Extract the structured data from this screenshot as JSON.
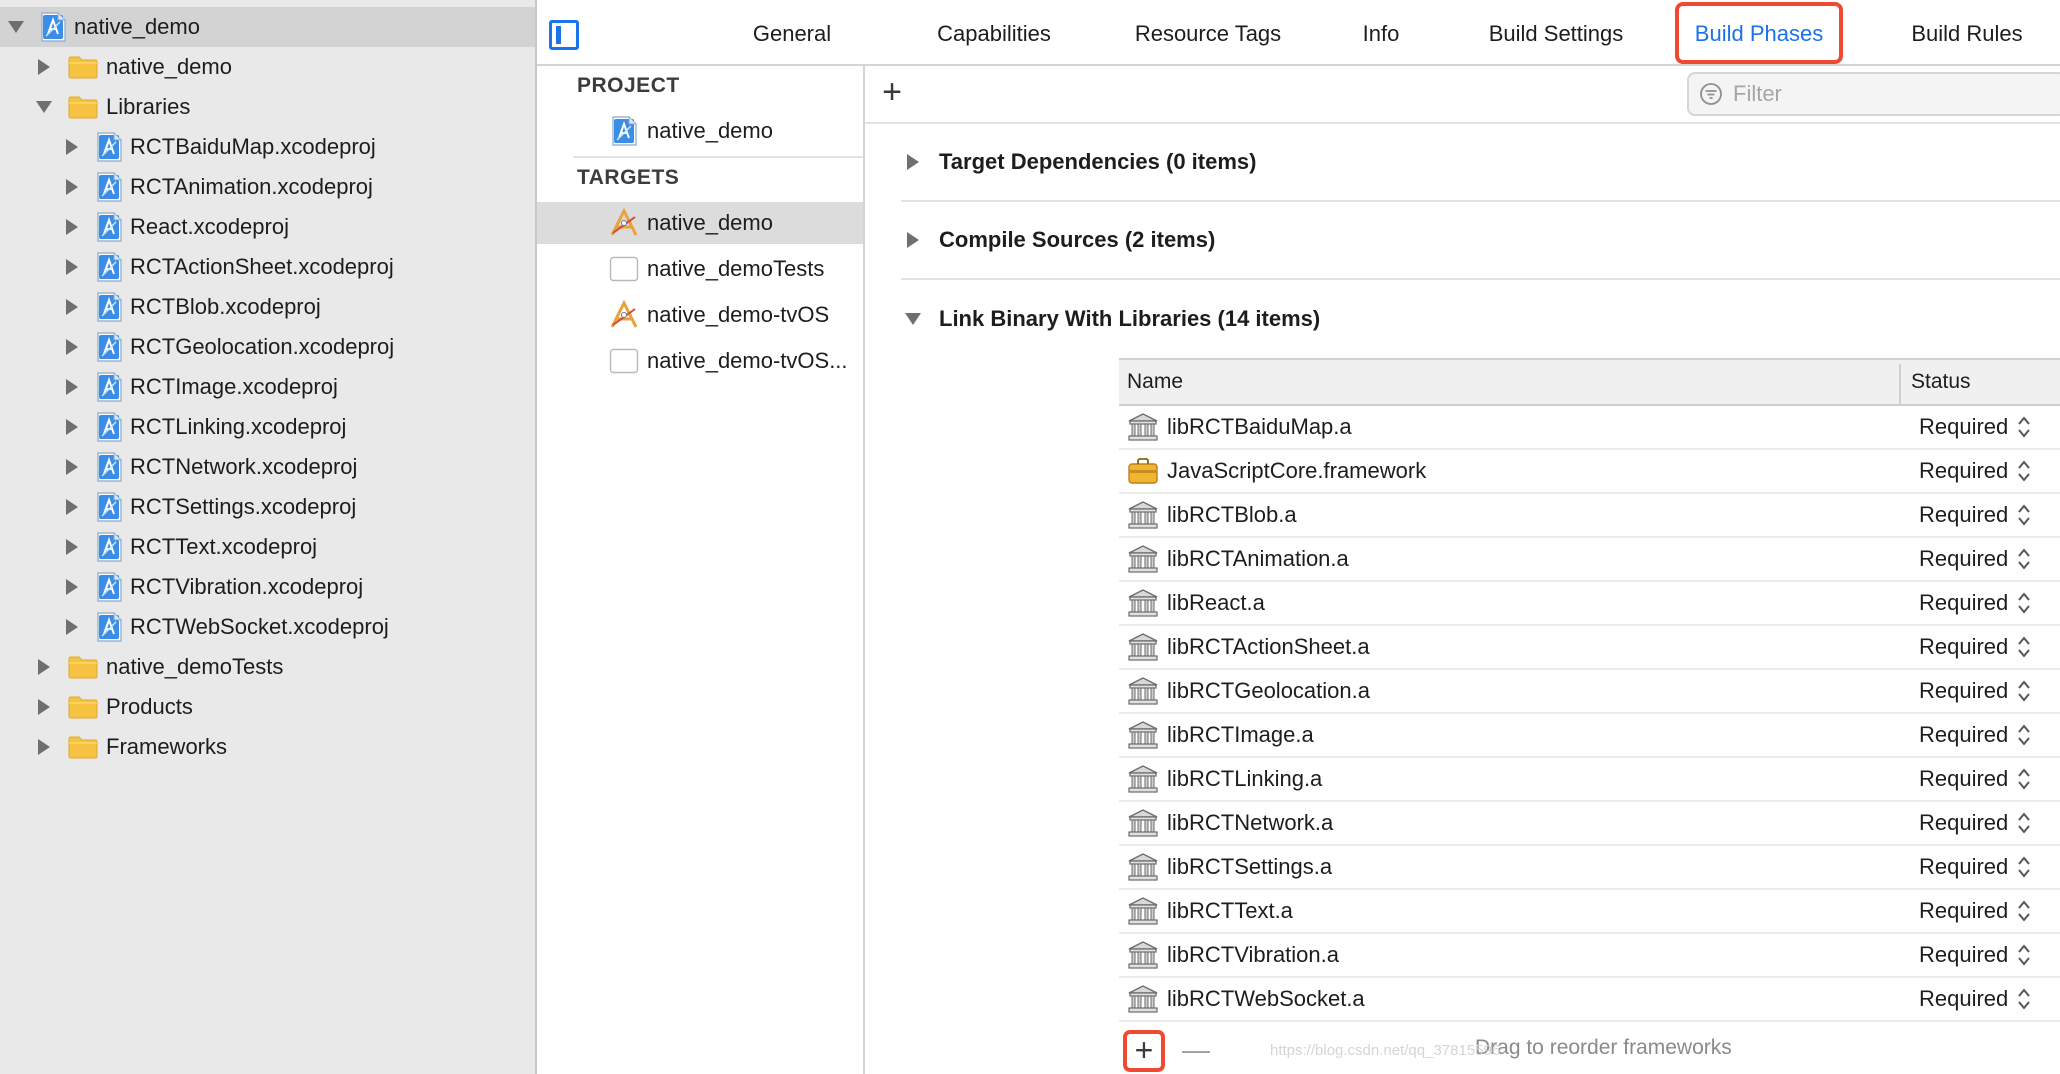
{
  "navigator": {
    "items": [
      {
        "label": "native_demo",
        "indent": 0,
        "expanded": true,
        "icon": "xcodeproj-icon",
        "selected": true
      },
      {
        "label": "native_demo",
        "indent": 1,
        "expanded": false,
        "icon": "folder-icon"
      },
      {
        "label": "Libraries",
        "indent": 1,
        "expanded": true,
        "icon": "folder-icon"
      },
      {
        "label": "RCTBaiduMap.xcodeproj",
        "indent": 2,
        "expanded": false,
        "icon": "xcodeproj-icon"
      },
      {
        "label": "RCTAnimation.xcodeproj",
        "indent": 2,
        "expanded": false,
        "icon": "xcodeproj-icon"
      },
      {
        "label": "React.xcodeproj",
        "indent": 2,
        "expanded": false,
        "icon": "xcodeproj-icon"
      },
      {
        "label": "RCTActionSheet.xcodeproj",
        "indent": 2,
        "expanded": false,
        "icon": "xcodeproj-icon"
      },
      {
        "label": "RCTBlob.xcodeproj",
        "indent": 2,
        "expanded": false,
        "icon": "xcodeproj-icon"
      },
      {
        "label": "RCTGeolocation.xcodeproj",
        "indent": 2,
        "expanded": false,
        "icon": "xcodeproj-icon"
      },
      {
        "label": "RCTImage.xcodeproj",
        "indent": 2,
        "expanded": false,
        "icon": "xcodeproj-icon"
      },
      {
        "label": "RCTLinking.xcodeproj",
        "indent": 2,
        "expanded": false,
        "icon": "xcodeproj-icon"
      },
      {
        "label": "RCTNetwork.xcodeproj",
        "indent": 2,
        "expanded": false,
        "icon": "xcodeproj-icon"
      },
      {
        "label": "RCTSettings.xcodeproj",
        "indent": 2,
        "expanded": false,
        "icon": "xcodeproj-icon"
      },
      {
        "label": "RCTText.xcodeproj",
        "indent": 2,
        "expanded": false,
        "icon": "xcodeproj-icon"
      },
      {
        "label": "RCTVibration.xcodeproj",
        "indent": 2,
        "expanded": false,
        "icon": "xcodeproj-icon"
      },
      {
        "label": "RCTWebSocket.xcodeproj",
        "indent": 2,
        "expanded": false,
        "icon": "xcodeproj-icon"
      },
      {
        "label": "native_demoTests",
        "indent": 1,
        "expanded": false,
        "icon": "folder-icon"
      },
      {
        "label": "Products",
        "indent": 1,
        "expanded": false,
        "icon": "folder-icon"
      },
      {
        "label": "Frameworks",
        "indent": 1,
        "expanded": false,
        "icon": "folder-icon"
      }
    ]
  },
  "tabs": [
    {
      "label": "General",
      "active": false
    },
    {
      "label": "Capabilities",
      "active": false
    },
    {
      "label": "Resource Tags",
      "active": false
    },
    {
      "label": "Info",
      "active": false
    },
    {
      "label": "Build Settings",
      "active": false
    },
    {
      "label": "Build Phases",
      "active": true
    },
    {
      "label": "Build Rules",
      "active": false
    }
  ],
  "targets": {
    "project_heading": "PROJECT",
    "project_item": {
      "label": "native_demo",
      "icon": "xcodeproj-icon"
    },
    "targets_heading": "TARGETS",
    "items": [
      {
        "label": "native_demo",
        "icon": "app-target-icon",
        "selected": true
      },
      {
        "label": "native_demoTests",
        "icon": "test-target-icon",
        "selected": false
      },
      {
        "label": "native_demo-tvOS",
        "icon": "app-target-icon",
        "selected": false
      },
      {
        "label": "native_demo-tvOS...",
        "icon": "test-target-icon",
        "selected": false
      }
    ]
  },
  "phases": {
    "add_label": "+",
    "filter_placeholder": "Filter",
    "sections": [
      {
        "title": "Target Dependencies (0 items)",
        "expanded": false
      },
      {
        "title": "Compile Sources (2 items)",
        "expanded": false
      },
      {
        "title": "Link Binary With Libraries (14 items)",
        "expanded": true
      }
    ],
    "table": {
      "col_name": "Name",
      "col_status": "Status",
      "rows": [
        {
          "name": "libRCTBaiduMap.a",
          "status": "Required",
          "icon": "library-icon"
        },
        {
          "name": "JavaScriptCore.framework",
          "status": "Required",
          "icon": "framework-icon"
        },
        {
          "name": "libRCTBlob.a",
          "status": "Required",
          "icon": "library-icon"
        },
        {
          "name": "libRCTAnimation.a",
          "status": "Required",
          "icon": "library-icon"
        },
        {
          "name": "libReact.a",
          "status": "Required",
          "icon": "library-icon"
        },
        {
          "name": "libRCTActionSheet.a",
          "status": "Required",
          "icon": "library-icon"
        },
        {
          "name": "libRCTGeolocation.a",
          "status": "Required",
          "icon": "library-icon"
        },
        {
          "name": "libRCTImage.a",
          "status": "Required",
          "icon": "library-icon"
        },
        {
          "name": "libRCTLinking.a",
          "status": "Required",
          "icon": "library-icon"
        },
        {
          "name": "libRCTNetwork.a",
          "status": "Required",
          "icon": "library-icon"
        },
        {
          "name": "libRCTSettings.a",
          "status": "Required",
          "icon": "library-icon"
        },
        {
          "name": "libRCTText.a",
          "status": "Required",
          "icon": "library-icon"
        },
        {
          "name": "libRCTVibration.a",
          "status": "Required",
          "icon": "library-icon"
        },
        {
          "name": "libRCTWebSocket.a",
          "status": "Required",
          "icon": "library-icon"
        }
      ],
      "add_label": "+",
      "remove_label": "—",
      "drag_hint": "Drag to reorder frameworks"
    }
  },
  "watermark": "https://blog.csdn.net/qq_37815596",
  "colors": {
    "accent": "#1a73e8",
    "highlight_box": "#ef4a31",
    "navigator_bg": "#e9e9e9"
  }
}
